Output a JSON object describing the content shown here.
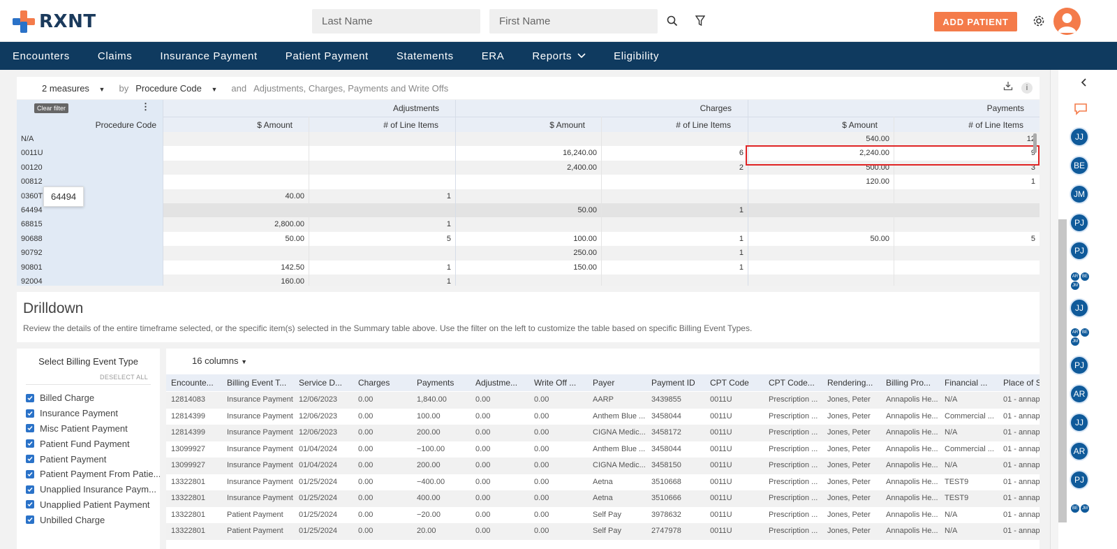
{
  "brand": {
    "name": "RXNT",
    "accent": "#f47b4a",
    "nav_bg": "#0f3a5f"
  },
  "header": {
    "last_name_placeholder": "Last Name",
    "first_name_placeholder": "First Name",
    "add_patient_label": "ADD PATIENT",
    "icons": [
      "search-icon",
      "filter-icon",
      "gear-icon",
      "user-avatar"
    ]
  },
  "nav": {
    "items": [
      "Encounters",
      "Claims",
      "Insurance Payment",
      "Patient Payment",
      "Statements",
      "ERA",
      "Reports",
      "Eligibility"
    ]
  },
  "summary": {
    "measures": "2 measures",
    "by": "by",
    "dimension": "Procedure Code",
    "and": "and",
    "columns_desc": "Adjustments, Charges, Payments and Write Offs",
    "clear_filter": "Clear filter",
    "row_header": "Procedure Code",
    "groups": [
      "Adjustments",
      "Charges",
      "Payments"
    ],
    "sub_amount": "$ Amount",
    "sub_items": "# of Line Items",
    "tooltip": "64494",
    "rows": [
      {
        "code": "N/A",
        "adj_amt": "",
        "adj_n": "",
        "chg_amt": "",
        "chg_n": "",
        "pay_amt": "540.00",
        "pay_n": "12"
      },
      {
        "code": "0011U",
        "adj_amt": "",
        "adj_n": "",
        "chg_amt": "16,240.00",
        "chg_n": "6",
        "pay_amt": "2,240.00",
        "pay_n": "9"
      },
      {
        "code": "00120",
        "adj_amt": "",
        "adj_n": "",
        "chg_amt": "2,400.00",
        "chg_n": "2",
        "pay_amt": "500.00",
        "pay_n": "3"
      },
      {
        "code": "00812",
        "adj_amt": "",
        "adj_n": "",
        "chg_amt": "",
        "chg_n": "",
        "pay_amt": "120.00",
        "pay_n": "1"
      },
      {
        "code": "0360T",
        "adj_amt": "40.00",
        "adj_n": "1",
        "chg_amt": "",
        "chg_n": "",
        "pay_amt": "",
        "pay_n": ""
      },
      {
        "code": "64494",
        "adj_amt": "",
        "adj_n": "",
        "chg_amt": "50.00",
        "chg_n": "1",
        "pay_amt": "",
        "pay_n": ""
      },
      {
        "code": "68815",
        "adj_amt": "2,800.00",
        "adj_n": "1",
        "chg_amt": "",
        "chg_n": "",
        "pay_amt": "",
        "pay_n": ""
      },
      {
        "code": "90688",
        "adj_amt": "50.00",
        "adj_n": "5",
        "chg_amt": "100.00",
        "chg_n": "1",
        "pay_amt": "50.00",
        "pay_n": "5"
      },
      {
        "code": "90792",
        "adj_amt": "",
        "adj_n": "",
        "chg_amt": "250.00",
        "chg_n": "1",
        "pay_amt": "",
        "pay_n": ""
      },
      {
        "code": "90801",
        "adj_amt": "142.50",
        "adj_n": "1",
        "chg_amt": "150.00",
        "chg_n": "1",
        "pay_amt": "",
        "pay_n": ""
      },
      {
        "code": "92004",
        "adj_amt": "160.00",
        "adj_n": "1",
        "chg_amt": "",
        "chg_n": "",
        "pay_amt": "",
        "pay_n": ""
      }
    ]
  },
  "drilldown": {
    "title": "Drilldown",
    "description": "Review the details of the entire timeframe selected, or the specific item(s) selected in the Summary table above. Use the filter on the left to customize the table based on specific Billing Event Types."
  },
  "billing_filter": {
    "title": "Select Billing Event Type",
    "deselect_all": "DESELECT ALL",
    "items": [
      "Billed Charge",
      "Insurance Payment",
      "Misc Patient Payment",
      "Patient Fund Payment",
      "Patient Payment",
      "Patient Payment From Patie...",
      "Unapplied Insurance Paym...",
      "Unapplied Patient Payment",
      "Unbilled Charge"
    ]
  },
  "detail_table": {
    "columns_label": "16 columns",
    "headers": [
      "Encounte...",
      "Billing Event T...",
      "Service D...",
      "Charges",
      "Payments",
      "Adjustme...",
      "Write Off ...",
      "Payer",
      "Payment ID",
      "CPT Code",
      "CPT Code...",
      "Rendering...",
      "Billing Pro...",
      "Financial ...",
      "Place of S..."
    ],
    "rows": [
      [
        "12814083",
        "Insurance Payment",
        "12/06/2023",
        "0.00",
        "1,840.00",
        "0.00",
        "0.00",
        "AARP",
        "3439855",
        "0011U",
        "Prescription ...",
        "Jones, Peter",
        "Annapolis He...",
        "N/A",
        "01 - annap"
      ],
      [
        "12814399",
        "Insurance Payment",
        "12/06/2023",
        "0.00",
        "100.00",
        "0.00",
        "0.00",
        "Anthem Blue ...",
        "3458044",
        "0011U",
        "Prescription ...",
        "Jones, Peter",
        "Annapolis He...",
        "Commercial ...",
        "01 - annap"
      ],
      [
        "12814399",
        "Insurance Payment",
        "12/06/2023",
        "0.00",
        "200.00",
        "0.00",
        "0.00",
        "CIGNA Medic...",
        "3458172",
        "0011U",
        "Prescription ...",
        "Jones, Peter",
        "Annapolis He...",
        "N/A",
        "01 - annap"
      ],
      [
        "13099927",
        "Insurance Payment",
        "01/04/2024",
        "0.00",
        "−100.00",
        "0.00",
        "0.00",
        "Anthem Blue ...",
        "3458044",
        "0011U",
        "Prescription ...",
        "Jones, Peter",
        "Annapolis He...",
        "Commercial ...",
        "01 - annap"
      ],
      [
        "13099927",
        "Insurance Payment",
        "01/04/2024",
        "0.00",
        "200.00",
        "0.00",
        "0.00",
        "CIGNA Medic...",
        "3458150",
        "0011U",
        "Prescription ...",
        "Jones, Peter",
        "Annapolis He...",
        "N/A",
        "01 - annap"
      ],
      [
        "13322801",
        "Insurance Payment",
        "01/25/2024",
        "0.00",
        "−400.00",
        "0.00",
        "0.00",
        "Aetna",
        "3510668",
        "0011U",
        "Prescription ...",
        "Jones, Peter",
        "Annapolis He...",
        "TEST9",
        "01 - annap"
      ],
      [
        "13322801",
        "Insurance Payment",
        "01/25/2024",
        "0.00",
        "400.00",
        "0.00",
        "0.00",
        "Aetna",
        "3510666",
        "0011U",
        "Prescription ...",
        "Jones, Peter",
        "Annapolis He...",
        "TEST9",
        "01 - annap"
      ],
      [
        "13322801",
        "Patient Payment",
        "01/25/2024",
        "0.00",
        "−20.00",
        "0.00",
        "0.00",
        "Self Pay",
        "3978632",
        "0011U",
        "Prescription ...",
        "Jones, Peter",
        "Annapolis He...",
        "N/A",
        "01 - annap"
      ],
      [
        "13322801",
        "Patient Payment",
        "01/25/2024",
        "0.00",
        "20.00",
        "0.00",
        "0.00",
        "Self Pay",
        "2747978",
        "0011U",
        "Prescription ...",
        "Jones, Peter",
        "Annapolis He...",
        "N/A",
        "01 - annap"
      ]
    ]
  },
  "sidebar": {
    "avatars": [
      "JJ",
      "BE",
      "JM",
      "PJ",
      "PJ",
      "JJ",
      "PJ",
      "AR",
      "JJ",
      "AR",
      "PJ"
    ],
    "groups": [
      [
        "AR",
        "BE",
        "JM"
      ],
      [
        "AR",
        "BE",
        "JM"
      ],
      [
        "BE",
        "JM"
      ]
    ]
  }
}
